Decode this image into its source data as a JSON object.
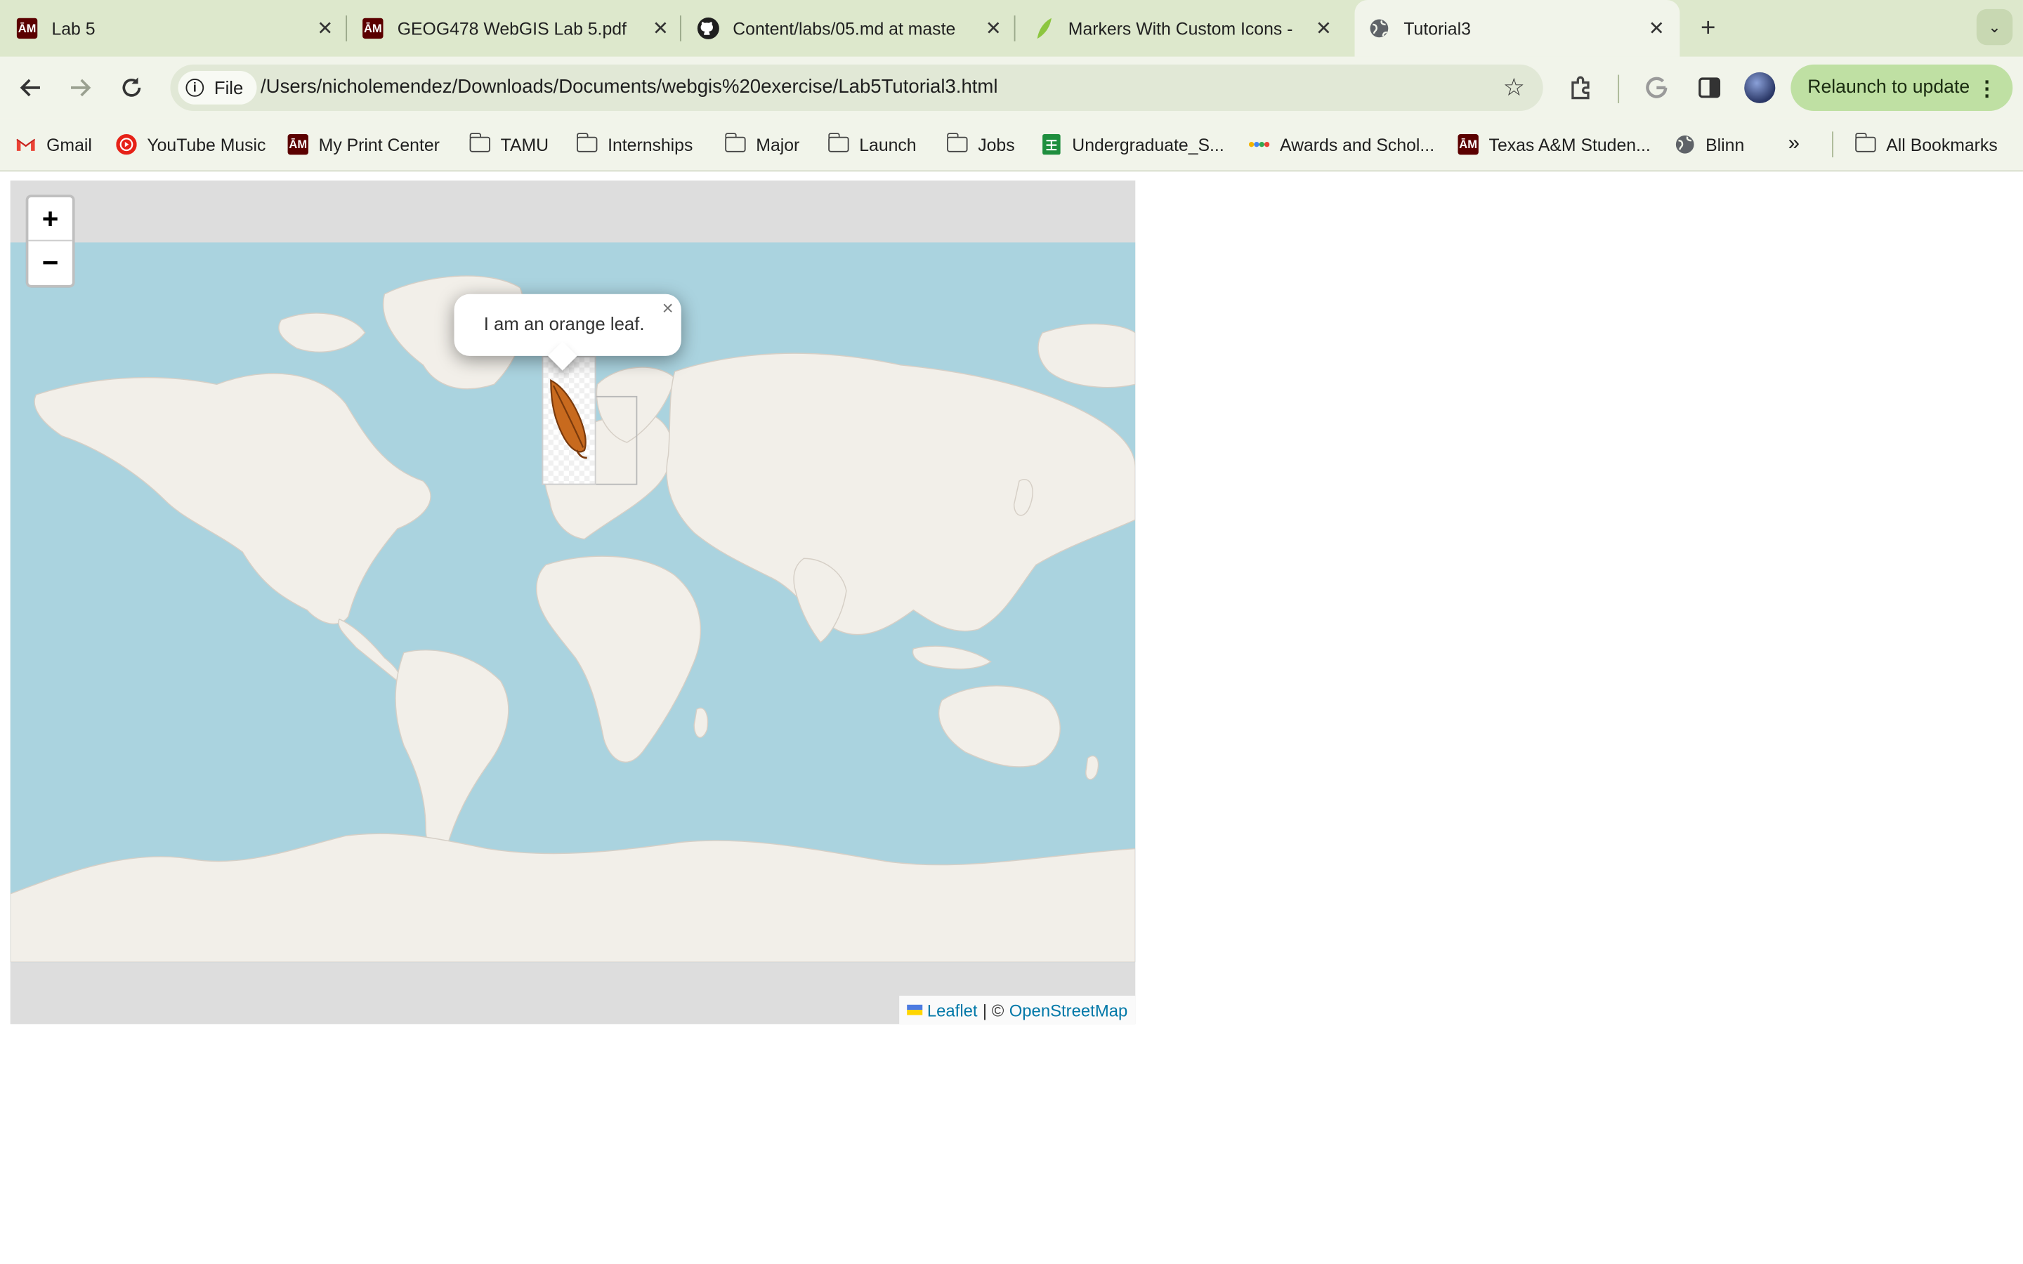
{
  "tabs": [
    {
      "title": "Lab 5",
      "icon": "tamu-icon"
    },
    {
      "title": "GEOG478 WebGIS Lab 5.pdf",
      "icon": "tamu-icon"
    },
    {
      "title": "Content/labs/05.md at maste",
      "icon": "github-icon"
    },
    {
      "title": "Markers With Custom Icons -",
      "icon": "leaf-icon"
    },
    {
      "title": "Tutorial3",
      "icon": "globe-icon"
    }
  ],
  "toolbar": {
    "file_chip": "File",
    "url": "/Users/nicholemendez/Downloads/Documents/webgis%20exercise/Lab5Tutorial3.html",
    "relaunch": "Relaunch to update"
  },
  "bookmarks": [
    {
      "label": "Gmail",
      "icon": "gmail-icon"
    },
    {
      "label": "YouTube Music",
      "icon": "youtube-music-icon"
    },
    {
      "label": "My Print Center",
      "icon": "tamu-icon"
    },
    {
      "label": "TAMU",
      "icon": "folder-icon"
    },
    {
      "label": "Internships",
      "icon": "folder-icon"
    },
    {
      "label": "Major",
      "icon": "folder-icon"
    },
    {
      "label": "Launch",
      "icon": "folder-icon"
    },
    {
      "label": "Jobs",
      "icon": "folder-icon"
    },
    {
      "label": "Undergraduate_S...",
      "icon": "sheets-icon"
    },
    {
      "label": "Awards and Schol...",
      "icon": "awards-icon"
    },
    {
      "label": "Texas A&M Studen...",
      "icon": "tamu-icon"
    },
    {
      "label": "Blinn",
      "icon": "globe-icon"
    }
  ],
  "all_bookmarks": "All Bookmarks",
  "map": {
    "zoom_in": "+",
    "zoom_out": "−",
    "popup_text": "I am an orange leaf.",
    "popup_close": "×",
    "attribution": {
      "leaflet": "Leaflet",
      "separator": "| ©",
      "osm": "OpenStreetMap"
    }
  },
  "colors": {
    "ocean": "#aad3df",
    "land": "#f2efe9",
    "leaf": "#c86a1e",
    "link": "#0078a8"
  }
}
